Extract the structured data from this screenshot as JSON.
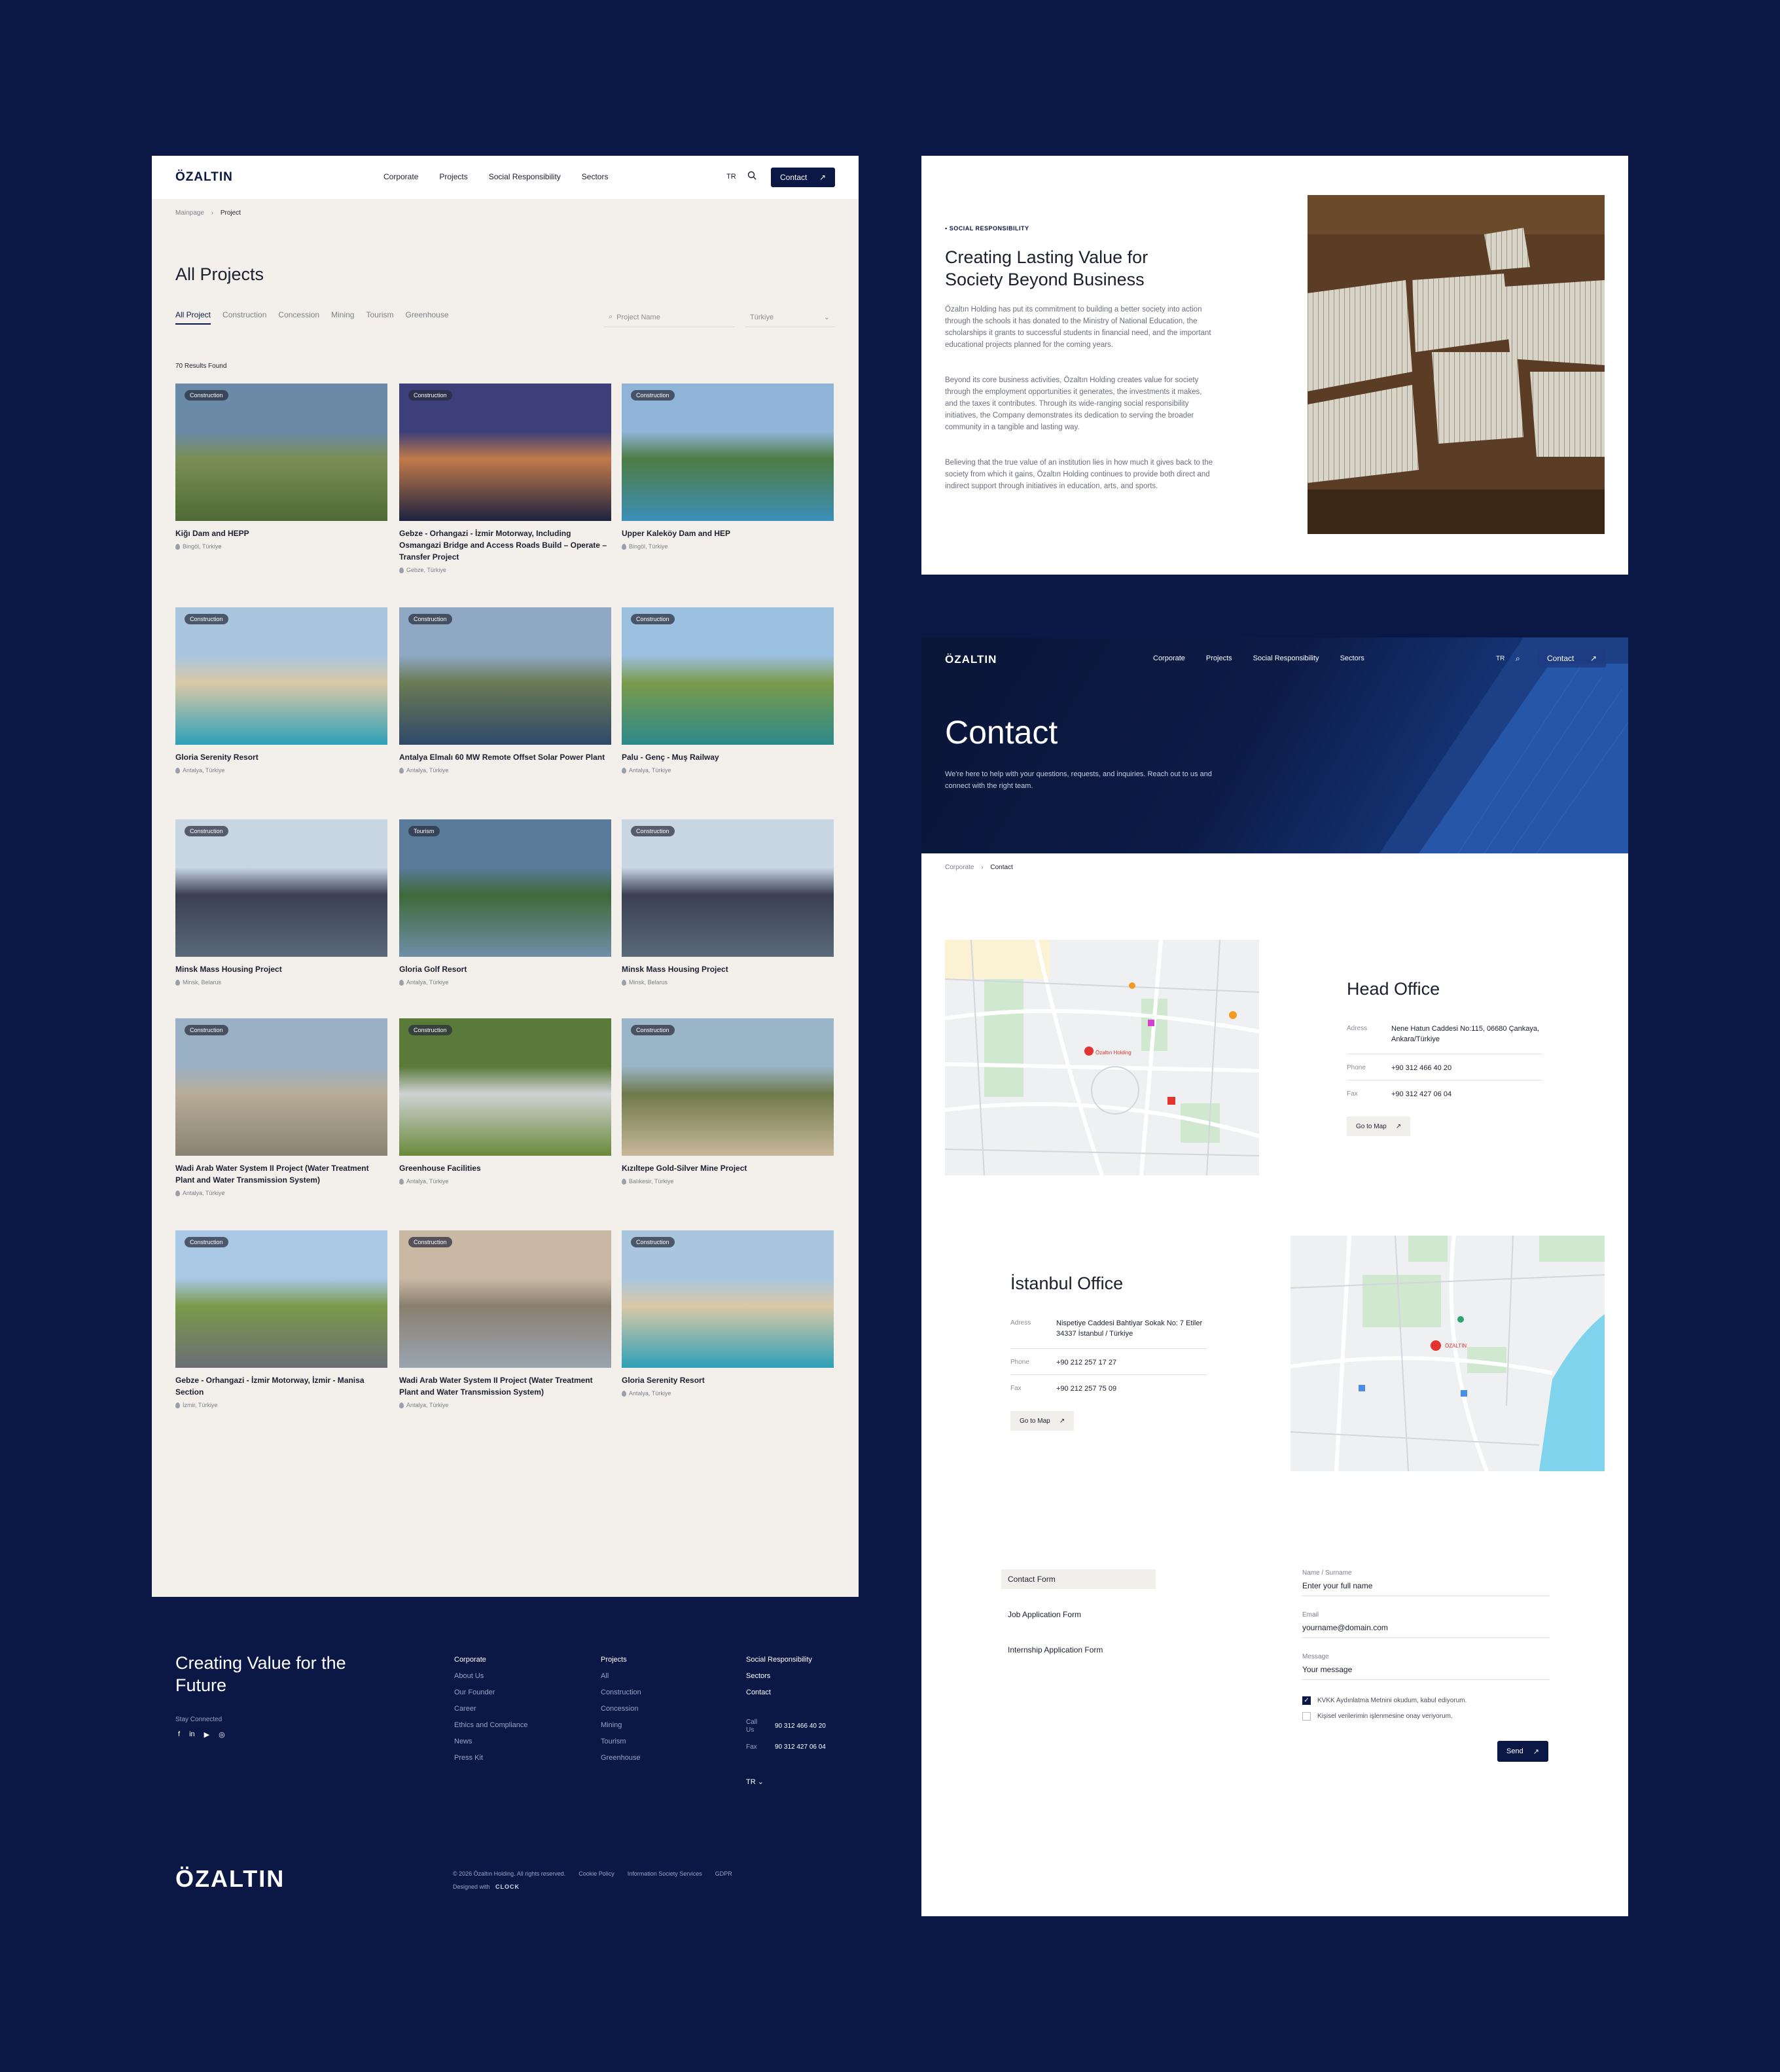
{
  "colors": {
    "navy": "#0b1846",
    "beige": "#f3f0ec",
    "white": "#ffffff"
  },
  "projects_page": {
    "logo": "ÖZALTIN",
    "nav": [
      "Corporate",
      "Projects",
      "Social Responsibility",
      "Sectors"
    ],
    "lang": "TR",
    "contact_btn": "Contact",
    "breadcrumb": {
      "home": "Mainpage",
      "current": "Project"
    },
    "title": "All Projects",
    "tabs": [
      "All Project",
      "Construction",
      "Concession",
      "Mining",
      "Tourism",
      "Greenhouse"
    ],
    "search_placeholder": "Project Name",
    "country_select": "Türkiye",
    "results": "70 Results Found",
    "cards": [
      {
        "badge": "Construction",
        "title": "Kiğı Dam and HEPP",
        "loc": "Bingöl, Türkiye"
      },
      {
        "badge": "Construction",
        "title": "Gebze - Orhangazi - İzmir Motorway, Including Osmangazi Bridge and Access Roads Build – Operate – Transfer Project",
        "loc": "Gebze, Türkiye"
      },
      {
        "badge": "Construction",
        "title": "Upper Kaleköy Dam and HEP",
        "loc": "Bingöl, Türkiye"
      },
      {
        "badge": "Construction",
        "title": "Gloria Serenity Resort",
        "loc": "Antalya, Türkiye"
      },
      {
        "badge": "Construction",
        "title": "Antalya Elmalı 60 MW Remote Offset Solar Power Plant",
        "loc": "Antalya, Türkiye"
      },
      {
        "badge": "Construction",
        "title": "Palu - Genç - Muş Railway",
        "loc": "Antalya, Türkiye"
      },
      {
        "badge": "Construction",
        "title": "Minsk Mass Housing Project",
        "loc": "Minsk, Belarus"
      },
      {
        "badge": "Tourism",
        "title": "Gloria Golf Resort",
        "loc": "Antalya, Türkiye"
      },
      {
        "badge": "Construction",
        "title": "Minsk Mass Housing Project",
        "loc": "Minsk, Belarus"
      },
      {
        "badge": "Construction",
        "title": "Wadi Arab Water System II Project (Water Treatment Plant and Water Transmission System)",
        "loc": "Antalya, Türkiye"
      },
      {
        "badge": "Construction",
        "title": "Greenhouse Facilities",
        "loc": "Antalya, Türkiye"
      },
      {
        "badge": "Construction",
        "title": "Kızıltepe Gold-Silver Mine Project",
        "loc": "Balıkesir, Türkiye"
      },
      {
        "badge": "Construction",
        "title": "Gebze - Orhangazi - İzmir Motorway, İzmir - Manisa Section",
        "loc": "İzmir, Türkiye"
      },
      {
        "badge": "Construction",
        "title": "Wadi Arab Water System II Project (Water Treatment Plant and Water Transmission System)",
        "loc": "Antalya, Türkiye"
      },
      {
        "badge": "Construction",
        "title": "Gloria Serenity Resort",
        "loc": "Antalya, Türkiye"
      }
    ],
    "footer": {
      "slogan": "Creating Value for the Future",
      "stay": "Stay Connected",
      "social": [
        "f",
        "in",
        "▶",
        "◎"
      ],
      "col1": [
        "Corporate",
        "About Us",
        "Our Founder",
        "Career",
        "Ethics and Compliance",
        "News",
        "Press Kit"
      ],
      "col2": [
        "Projects",
        "All",
        "Construction",
        "Concession",
        "Mining",
        "Tourism",
        "Greenhouse"
      ],
      "col3": [
        "Social Responsibility",
        "Sectors",
        "Contact"
      ],
      "call_label": "Call Us",
      "call": "90 312 466 40 20",
      "fax_label": "Fax",
      "fax": "90 312 427 06 04",
      "lang": "TR",
      "logo": "ÖZALTIN",
      "copyright": "© 2026 Özaltın Holding. All rights reserved.",
      "links": [
        "Cookie Policy",
        "Information Society Services",
        "GDPR"
      ],
      "designed": "Designed with",
      "designer": "CLOCK"
    }
  },
  "social_resp": {
    "eyebrow": "SOCIAL RESPONSIBILITY",
    "title": "Creating Lasting Value for Society Beyond Business",
    "p1": "Özaltın Holding has put its commitment to building a better society into action through the schools it has donated to the Ministry of National Education, the scholarships it grants to successful students in financial need, and the important educational projects planned for the coming years.",
    "p2": "Beyond its core business activities, Özaltın Holding creates value for society through the employment opportunities it generates, the investments it makes, and the taxes it contributes. Through its wide-ranging social responsibility initiatives, the Company demonstrates its dedication to serving the broader community in a tangible and lasting way.",
    "p3": "Believing that the true value of an institution lies in how much it gives back to the society from which it gains, Özaltın Holding continues to provide both direct and indirect support through initiatives in education, arts, and sports."
  },
  "contact_page": {
    "logo": "ÖZALTIN",
    "nav": [
      "Corporate",
      "Projects",
      "Social Responsibility",
      "Sectors"
    ],
    "lang": "TR",
    "contact_btn": "Contact",
    "title": "Contact",
    "subtitle": "We're here to help with your questions, requests, and inquiries. Reach out to us and connect with the right team.",
    "breadcrumb": {
      "home": "Corporate",
      "current": "Contact"
    },
    "head_office": {
      "title": "Head Office",
      "addr_label": "Adress",
      "addr": "Nene Hatun Caddesi No:115, 06680 Çankaya, Ankara/Türkiye",
      "phone_label": "Phone",
      "phone": "+90 312 466 40 20",
      "fax_label": "Fax",
      "fax": "+90 312 427 06 04",
      "map_btn": "Go to Map",
      "map_pin": "Özaltın Holding"
    },
    "istanbul_office": {
      "title": "İstanbul Office",
      "addr_label": "Adress",
      "addr": "Nispetiye Caddesi Bahtiyar Sokak No: 7 Etiler 34337 İstanbul / Türkiye",
      "phone_label": "Phone",
      "phone": "+90 212 257 17 27",
      "fax_label": "Fax",
      "fax": "+90 212 257 75 09",
      "map_btn": "Go to Map",
      "map_pin": "ÖZALTIN"
    },
    "form_tabs": [
      "Contact Form",
      "Job Application Form",
      "Internship Application Form"
    ],
    "form": {
      "name_label": "Name / Surname",
      "name_ph": "Enter your full name",
      "email_label": "Email",
      "email_ph": "yourname@domain.com",
      "msg_label": "Message",
      "msg_ph": "Your message",
      "chk1": "KVKK Aydınlatma Metnini okudum, kabul ediyorum.",
      "chk2": "Kişisel verilerimin işlenmesine onay veriyorum.",
      "send": "Send"
    }
  }
}
